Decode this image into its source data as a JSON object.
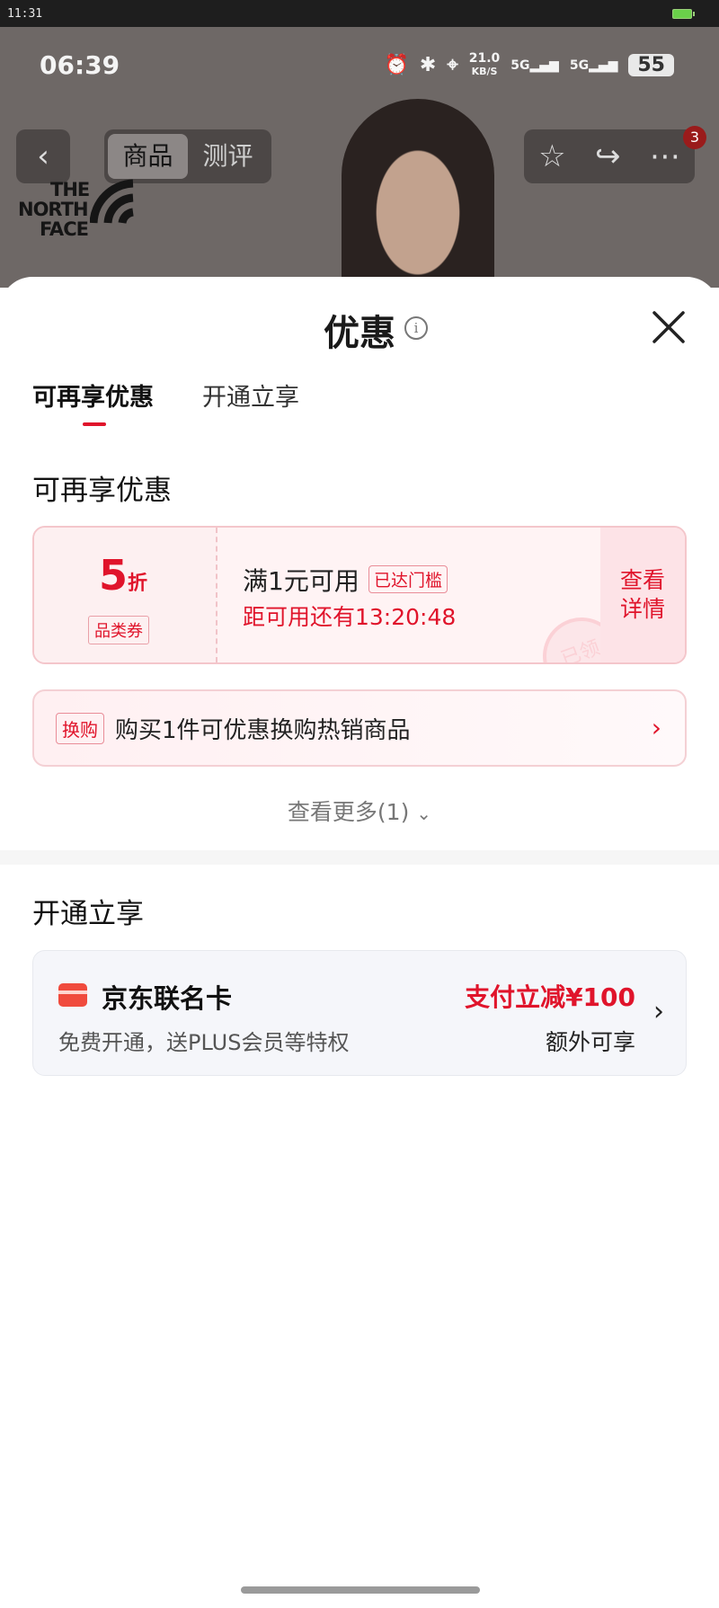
{
  "system_bar": {
    "time": "11:31"
  },
  "phone_status": {
    "time": "06:39",
    "net_speed": "21.0",
    "net_unit": "KB/S",
    "signal_1": "5G",
    "signal_2": "5G",
    "battery": "55"
  },
  "product_header": {
    "tabs": [
      "商品",
      "测评"
    ],
    "cart_badge": "3",
    "brand_lines": [
      "THE",
      "NORTH",
      "FACE"
    ]
  },
  "sheet": {
    "title": "优惠",
    "tabs": [
      "可再享优惠",
      "开通立享"
    ],
    "section1_title": "可再享优惠",
    "coupon": {
      "discount_value": "5",
      "discount_unit": "折",
      "kind": "品类券",
      "condition": "满1元可用",
      "threshold_tag": "已达门槛",
      "countdown": "距可用还有13:20:48",
      "detail_label": "查看详情",
      "stamp": "已领"
    },
    "swap": {
      "tag": "换购",
      "text": "购买1件可优惠换购热销商品"
    },
    "more_label": "查看更多(1)",
    "section2_title": "开通立享",
    "card": {
      "name": "京东联名卡",
      "desc": "免费开通，送PLUS会员等特权",
      "offer": "支付立减¥100",
      "extra": "额外可享"
    }
  },
  "colors": {
    "accent": "#e0142b",
    "coupon_bg": "#fff3f4",
    "card_bg": "#f5f6fa"
  }
}
